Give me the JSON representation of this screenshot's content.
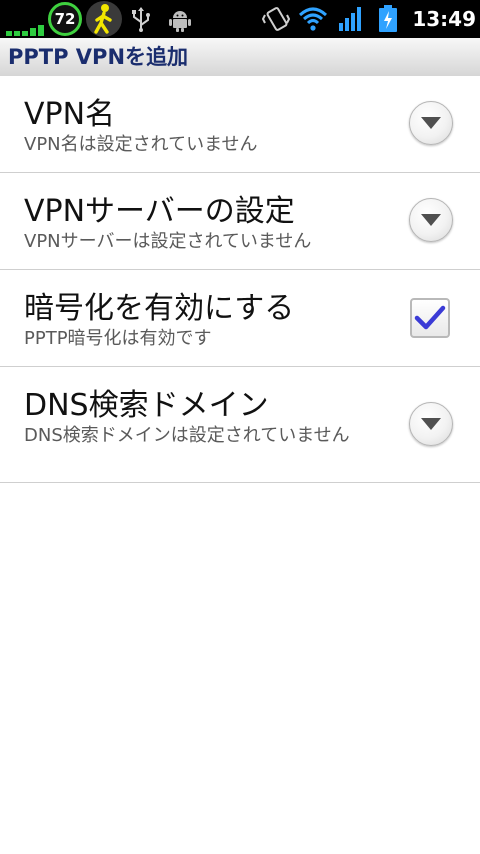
{
  "status_bar": {
    "battery_percent": "72",
    "time": "13:49",
    "icons": [
      "signal-bars-icon",
      "battery-level-icon",
      "walker-app-icon",
      "usb-icon",
      "android-debug-icon",
      "vibrate-icon",
      "wifi-icon",
      "cell-signal-icon",
      "battery-charging-icon"
    ]
  },
  "title_bar": {
    "title": "PPTP VPNを追加"
  },
  "preferences": [
    {
      "title": "VPN名",
      "summary": "VPN名は設定されていません",
      "control": "dropdown"
    },
    {
      "title": "VPNサーバーの設定",
      "summary": "VPNサーバーは設定されていません",
      "control": "dropdown"
    },
    {
      "title": "暗号化を有効にする",
      "summary": "PPTP暗号化は有効です",
      "control": "checkbox",
      "checked": true
    },
    {
      "title": "DNS検索ドメイン",
      "summary": "DNS検索ドメインは設定されていません",
      "control": "dropdown"
    }
  ],
  "colors": {
    "title_text": "#1a2d6e",
    "check_mark": "#3b3bd6",
    "battery_ring": "#3fd13f"
  }
}
